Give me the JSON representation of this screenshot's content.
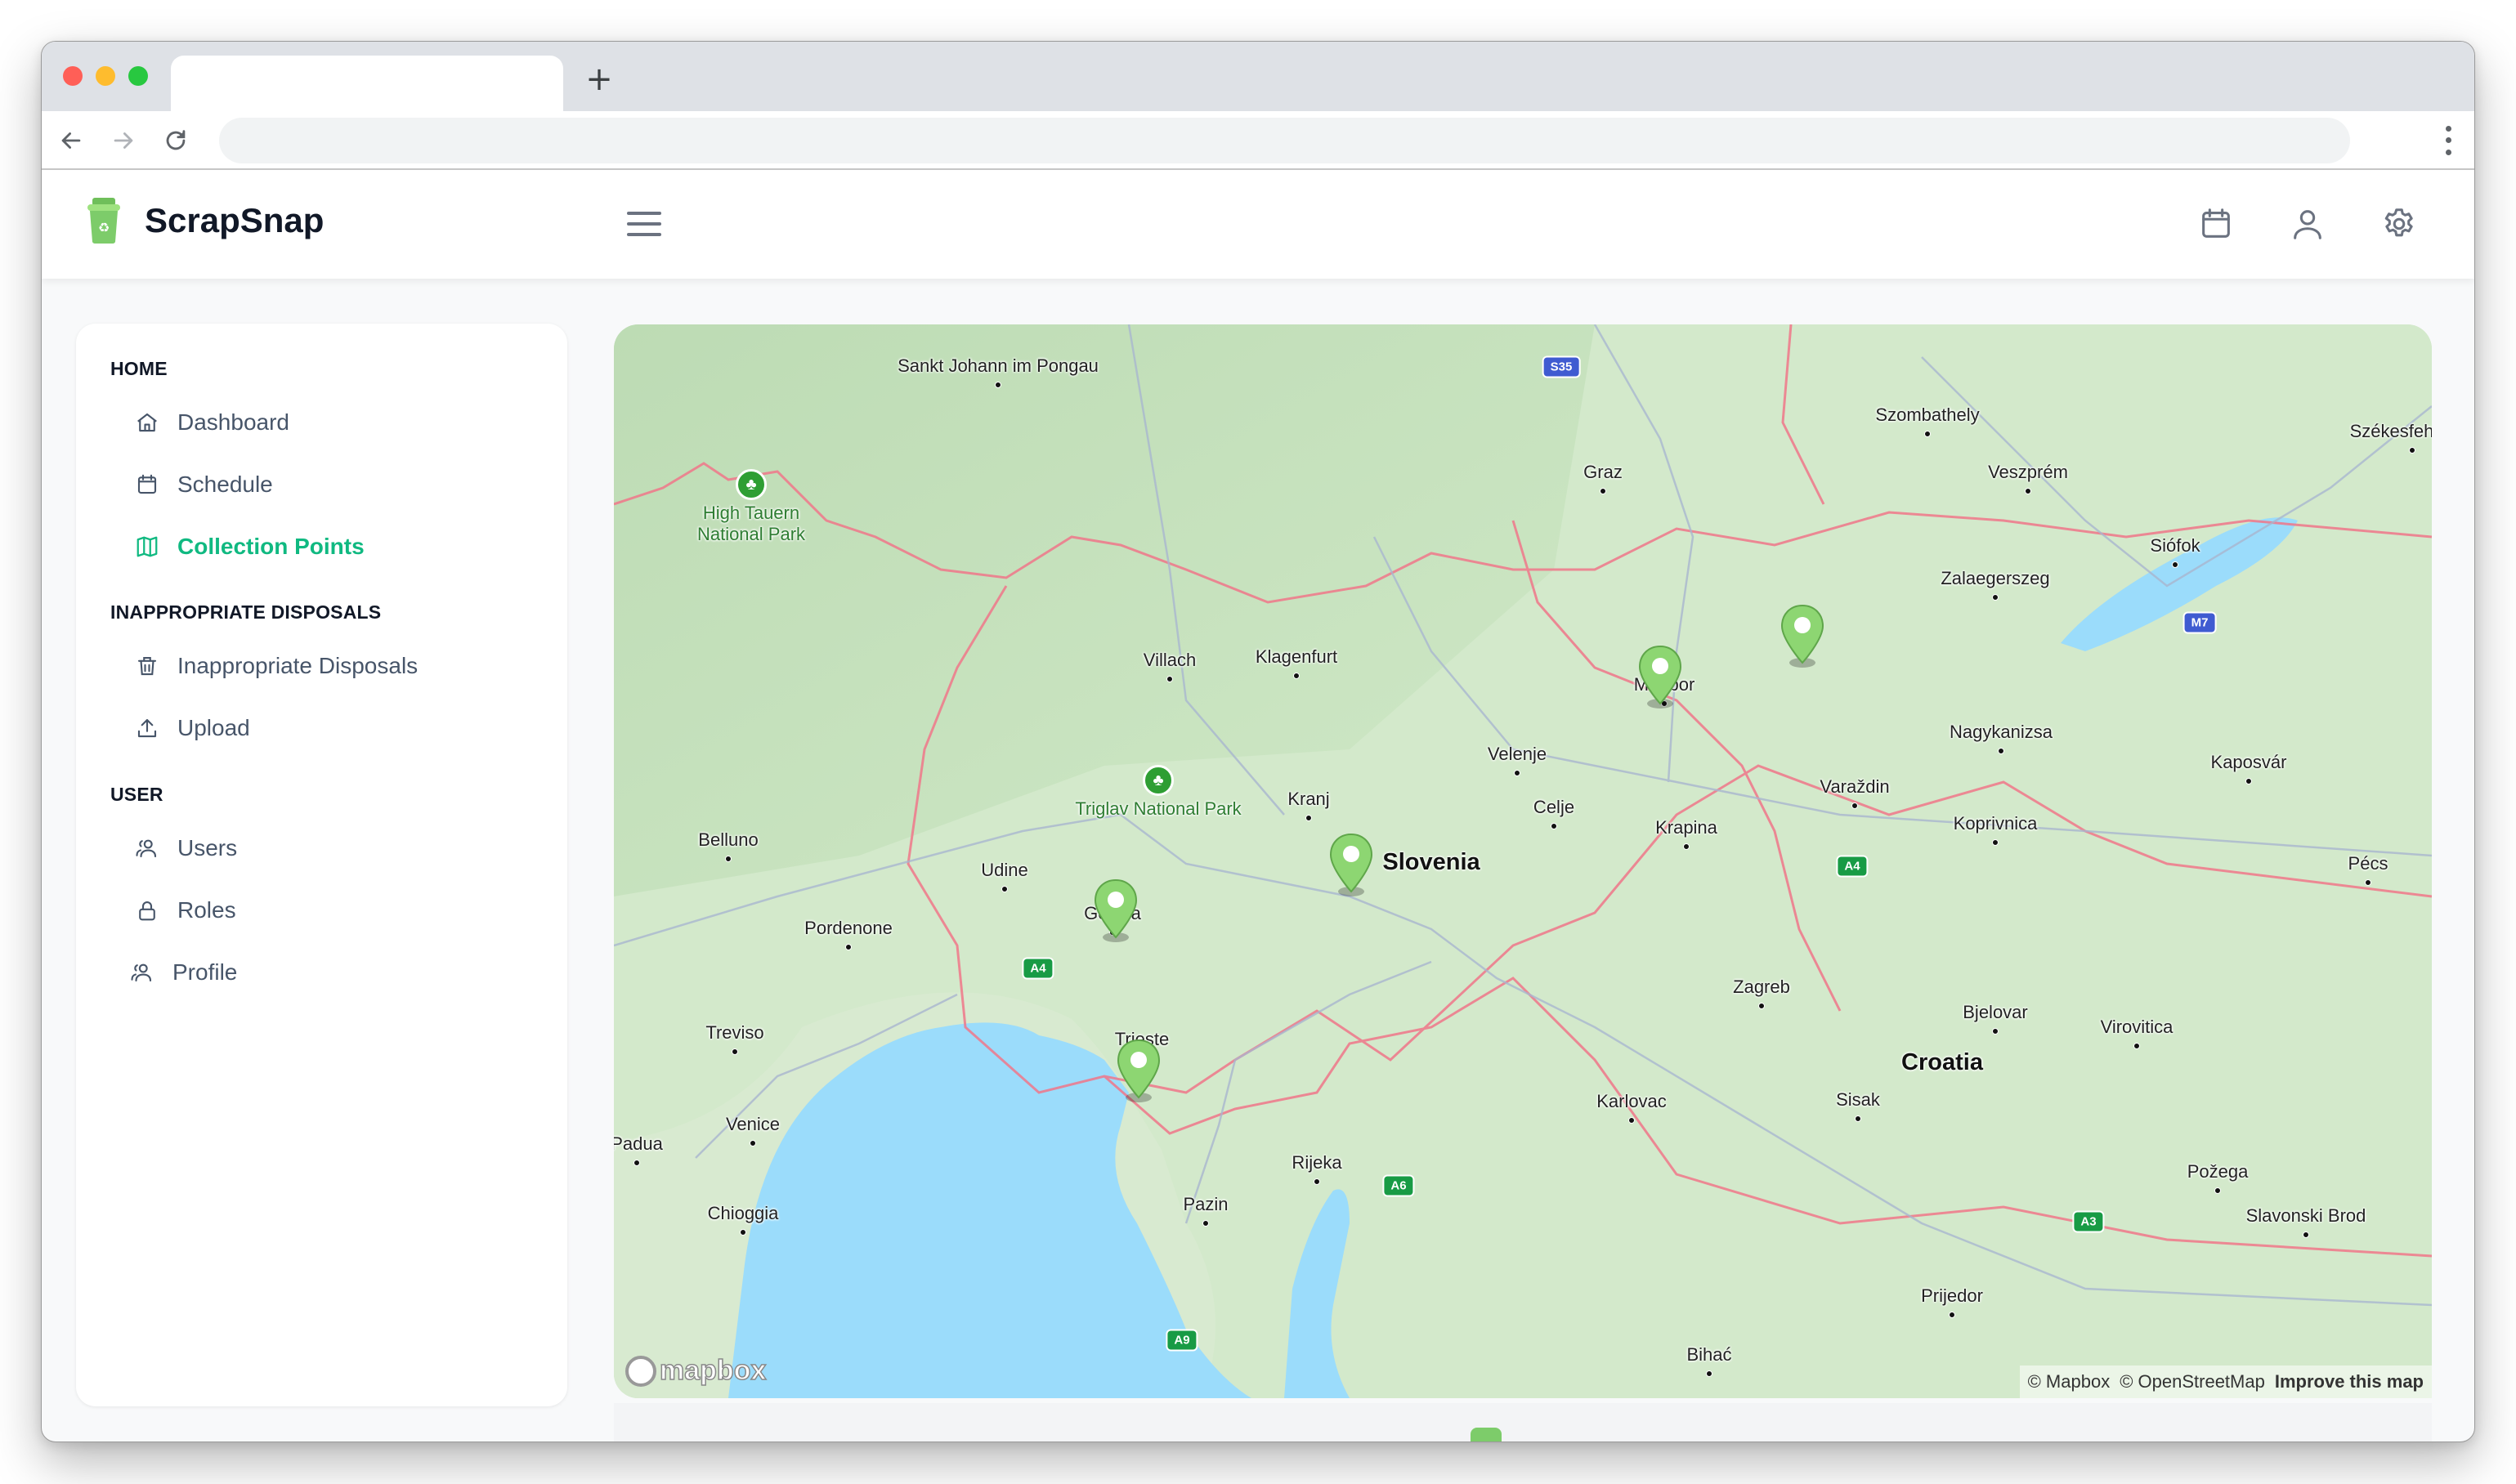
{
  "browser": {
    "tab_title": "",
    "new_tab_label": "+",
    "url": "",
    "nav_icons": [
      "back-arrow-icon",
      "forward-arrow-icon",
      "reload-icon"
    ],
    "menu_icon": "more-vertical-icon"
  },
  "app": {
    "brand": "ScrapSnap",
    "logo_icon": "recycle-bin-icon",
    "header_icons": [
      "calendar-icon",
      "user-icon",
      "gear-icon"
    ]
  },
  "sidebar": {
    "sections": [
      {
        "title": "HOME",
        "items": [
          {
            "label": "Dashboard",
            "icon": "home-icon",
            "active": false
          },
          {
            "label": "Schedule",
            "icon": "calendar-icon",
            "active": false
          },
          {
            "label": "Collection Points",
            "icon": "map-icon",
            "active": true
          }
        ]
      },
      {
        "title": "INAPPROPRIATE DISPOSALS",
        "items": [
          {
            "label": "Inappropriate Disposals",
            "icon": "trash-icon",
            "active": false
          },
          {
            "label": "Upload",
            "icon": "upload-icon",
            "active": false
          }
        ]
      },
      {
        "title": "USER",
        "items": [
          {
            "label": "Users",
            "icon": "users-icon",
            "active": false
          },
          {
            "label": "Roles",
            "icon": "lock-icon",
            "active": false
          },
          {
            "label": "Profile",
            "icon": "users-icon",
            "active": false
          }
        ]
      }
    ]
  },
  "colors": {
    "accent": "#10b981",
    "pin": "#8dd672",
    "water": "#9bdcfb",
    "border": "#f0778a"
  },
  "map": {
    "countries": [
      "Slovenia",
      "Croatia"
    ],
    "parks": [
      "High Tauern National Park",
      "Triglav National Park"
    ],
    "cities": [
      "Sankt Johann im Pongau",
      "Graz",
      "Szombathely",
      "Székesfehérvár",
      "Veszprém",
      "Siófok",
      "Zalaegerszeg",
      "Villach",
      "Klagenfurt",
      "Maribor",
      "Nagykanizsa",
      "Kaposvár",
      "Velenje",
      "Celje",
      "Varaždin",
      "Kranj",
      "Krapina",
      "Koprivnica",
      "Belluno",
      "Udine",
      "Gorizia",
      "Pordenone",
      "Pécs",
      "Zagreb",
      "Bjelovar",
      "Virovitica",
      "Treviso",
      "Trieste",
      "Karlovac",
      "Sisak",
      "Venice",
      "Padua",
      "Rijeka",
      "Požega",
      "Chioggia",
      "Pazin",
      "Slavonski Brod",
      "Prijedor",
      "Bihać"
    ],
    "road_shields": [
      "S35",
      "M7",
      "A4",
      "A4",
      "A6",
      "A3",
      "A9"
    ],
    "collection_points": 5,
    "attribution": {
      "mapbox": "© Mapbox",
      "osm": "© OpenStreetMap",
      "improve": "Improve this map"
    },
    "logo_text": "mapbox"
  }
}
